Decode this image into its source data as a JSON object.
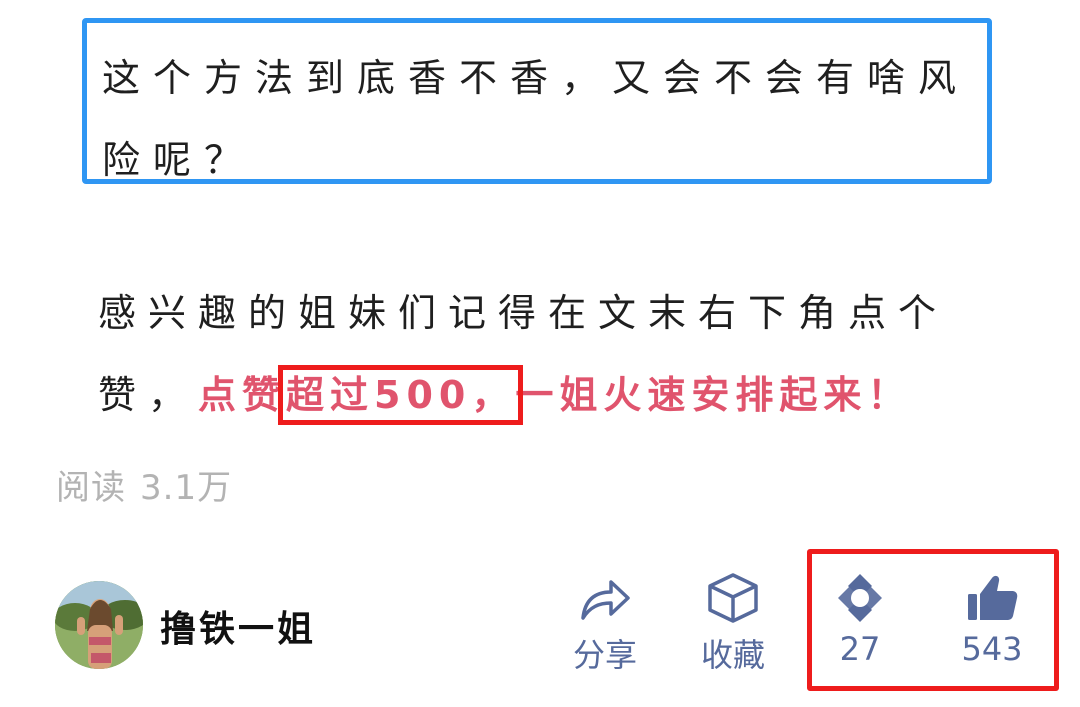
{
  "article": {
    "question_line": "这个方法到底香不香，又会不会有啥风险呢？",
    "cta_prefix": "感兴趣的姐妹们记得在文末右下角点个赞，",
    "cta_hl_1": "点赞",
    "cta_hl_boxed": "超过500，",
    "cta_hl_2": "一姐火速安排起来！"
  },
  "stats": {
    "read_label": "阅读",
    "read_value": "3.1万"
  },
  "author": {
    "name": "撸铁一姐"
  },
  "actions": {
    "share_label": "分享",
    "collect_label": "收藏",
    "watch_count": "27",
    "like_count": "543"
  },
  "colors": {
    "question_border": "#2f96f3",
    "highlight_border": "#ee1c1c",
    "cta_highlight": "#e0546d",
    "action_blue": "#566a9c"
  },
  "icons": [
    "share-icon",
    "collect-icon",
    "watch-icon",
    "like-icon"
  ]
}
